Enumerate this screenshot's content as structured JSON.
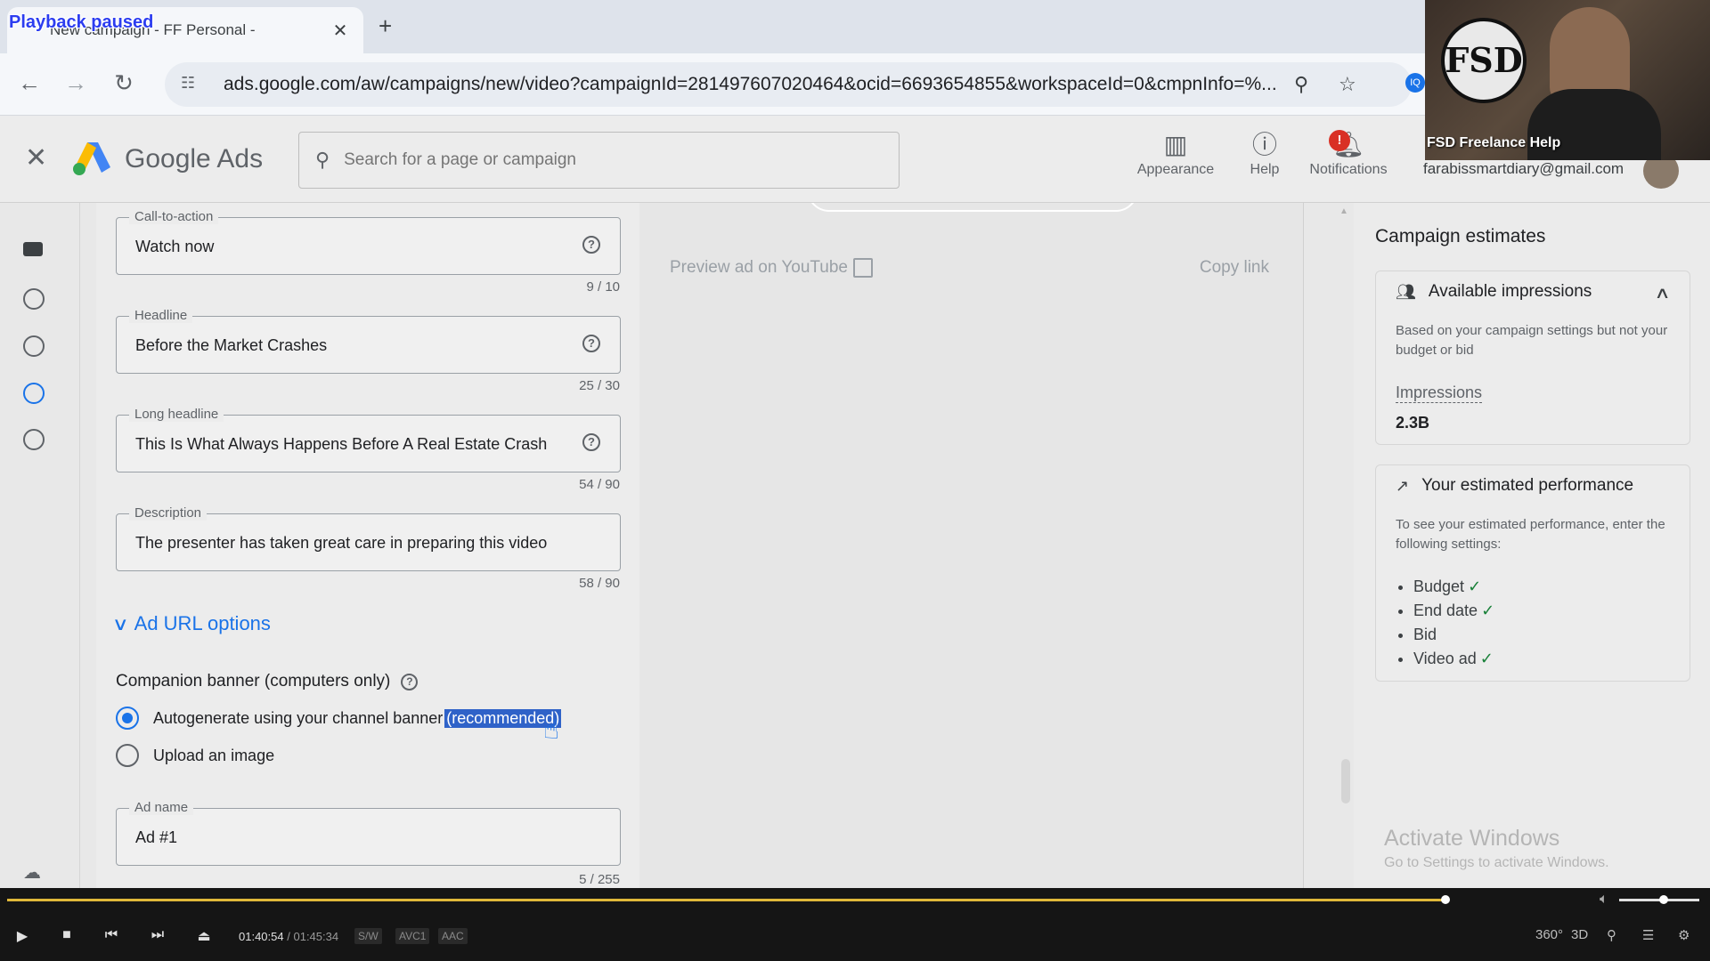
{
  "browser": {
    "tab_title": "New campaign - FF Personal -",
    "playback_overlay": "Playback paused",
    "url": "ads.google.com/aw/campaigns/new/video?campaignId=281497607020464&ocid=6693654855&workspaceId=0&cmpnInfo=%...",
    "extension_badge": "IQ"
  },
  "header": {
    "brand": "Google Ads",
    "search_placeholder": "Search for a page or campaign",
    "tools": [
      {
        "label": "Appearance",
        "icon": "appearance-icon"
      },
      {
        "label": "Help",
        "icon": "help-icon"
      },
      {
        "label": "Notifications",
        "icon": "bell-icon",
        "badge": "!"
      }
    ],
    "account_email": "farabissmartdiary@gmail.com"
  },
  "webcam": {
    "logo_text": "FSD",
    "label": "FSD Freelance Help"
  },
  "form": {
    "fields": [
      {
        "label": "Call-to-action",
        "value": "Watch now",
        "counter": "9 / 10"
      },
      {
        "label": "Headline",
        "value": "Before the Market Crashes",
        "counter": "25 / 30"
      },
      {
        "label": "Long headline",
        "value": "This Is What Always Happens Before A Real Estate Crash",
        "counter": "54 / 90"
      },
      {
        "label": "Description",
        "value": "The presenter has taken great care in preparing this video",
        "counter": "58 / 90"
      }
    ],
    "url_options_label": "Ad URL options",
    "companion_title": "Companion banner (computers only)",
    "radio_autogen": "Autogenerate using your channel banner",
    "radio_autogen_highlight": "(recommended)",
    "radio_upload": "Upload an image",
    "ad_name": {
      "label": "Ad name",
      "value": "Ad #1",
      "counter": "5 / 255"
    }
  },
  "preview": {
    "preview_link": "Preview ad on YouTube",
    "copy_link": "Copy link"
  },
  "estimates": {
    "title": "Campaign estimates",
    "impressions_card": {
      "title": "Available impressions",
      "desc": "Based on your campaign settings but not your budget or bid",
      "metric_label": "Impressions",
      "metric_value": "2.3B"
    },
    "performance_card": {
      "title": "Your estimated performance",
      "desc": "To see your estimated performance, enter the following settings:",
      "items": [
        {
          "label": "Budget",
          "done": "✓"
        },
        {
          "label": "End date",
          "done": "✓"
        },
        {
          "label": "Bid",
          "done": ""
        },
        {
          "label": "Video ad",
          "done": "✓"
        }
      ]
    }
  },
  "watermark": {
    "title": "Activate Windows",
    "subtitle": "Go to Settings to activate Windows."
  },
  "player": {
    "current_time": "01:40:54",
    "separator": "/",
    "total_time": "01:45:34",
    "tags": [
      "S/W",
      "AVC1",
      "AAC"
    ],
    "progress": 0.9555,
    "volume": 0.55,
    "right_labels": [
      "360°",
      "3D"
    ]
  }
}
